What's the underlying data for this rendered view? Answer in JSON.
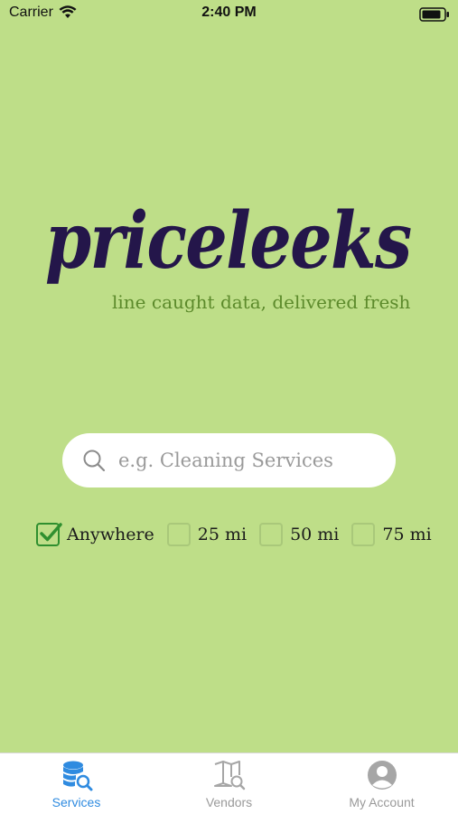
{
  "status_bar": {
    "carrier": "Carrier",
    "time": "2:40 PM"
  },
  "logo": {
    "wordmark": "priceleeks",
    "tagline": "line caught data, delivered fresh",
    "color": "#24164a"
  },
  "search": {
    "placeholder": "e.g. Cleaning Services",
    "value": ""
  },
  "filters": [
    {
      "label": "Anywhere",
      "checked": true
    },
    {
      "label": "25 mi",
      "checked": false
    },
    {
      "label": "50 mi",
      "checked": false
    },
    {
      "label": "75 mi",
      "checked": false
    }
  ],
  "tabs": [
    {
      "label": "Services",
      "icon": "database-search-icon",
      "active": true
    },
    {
      "label": "Vendors",
      "icon": "map-search-icon",
      "active": false
    },
    {
      "label": "My Account",
      "icon": "user-circle-icon",
      "active": false
    }
  ],
  "colors": {
    "background": "#bede88",
    "accent": "#2f8be0",
    "check": "#2f8f2f"
  }
}
